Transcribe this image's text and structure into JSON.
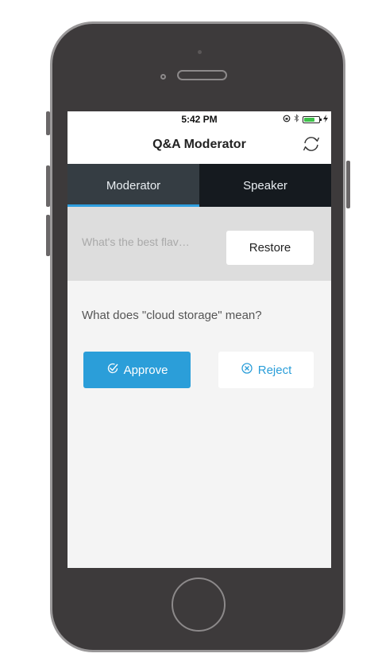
{
  "status_bar": {
    "time": "5:42 PM",
    "icons": [
      "lock-rotation-icon",
      "bluetooth-icon",
      "battery-icon",
      "charging-bolt-icon"
    ],
    "battery_level": 0.7,
    "battery_color": "#3ec14a"
  },
  "nav": {
    "title": "Q&A Moderator",
    "refresh_icon": "refresh-icon"
  },
  "tabs": [
    {
      "label": "Moderator",
      "active": true
    },
    {
      "label": "Speaker",
      "active": false
    }
  ],
  "archived": {
    "question": "What's the best flav…",
    "restore_label": "Restore"
  },
  "pending": {
    "question": "What does \"cloud storage\" mean?",
    "approve_label": "Approve",
    "approve_icon": "check-circle-icon",
    "reject_label": "Reject",
    "reject_icon": "x-circle-icon"
  },
  "colors": {
    "accent": "#2b9ed9",
    "tab_bar": "#151a1f",
    "tab_active": "#353d43",
    "device_body": "#3d3a3b"
  }
}
